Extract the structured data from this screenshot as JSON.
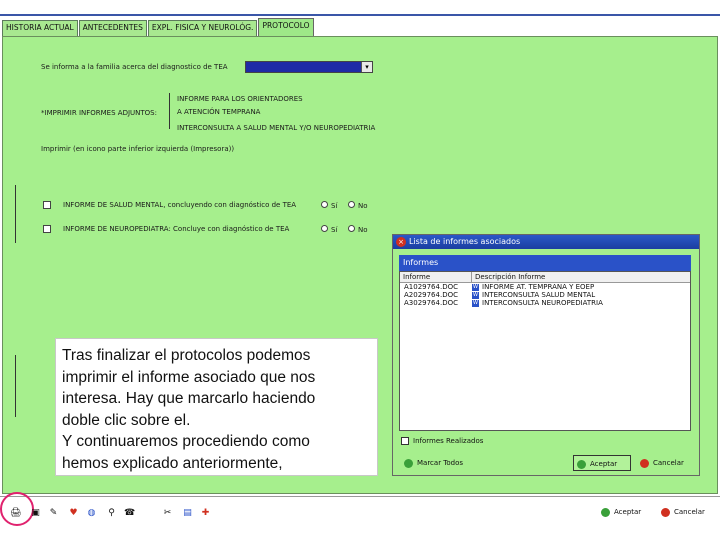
{
  "tabs": [
    {
      "label": "HISTORIA ACTUAL"
    },
    {
      "label": "ANTECEDENTES"
    },
    {
      "label": "EXPL. FISICA Y NEUROLÓG."
    },
    {
      "label": "PROTOCOLO"
    }
  ],
  "form": {
    "family_question": "Se informa a la familia acerca del diagnostico de TEA",
    "print_label": "*IMPRIMIR INFORMES ADJUNTOS:",
    "print_options": [
      "INFORME PARA LOS ORIENTADORES",
      "A ATENCIÓN TEMPRANA",
      "INTERCONSULTA A SALUD MENTAL Y/O NEUROPEDIATRIA"
    ],
    "print_hint": "Imprimir (en icono parte inferior izquierda (Impresora))",
    "report1": "INFORME DE SALUD MENTAL, concluyendo con diagnóstico de TEA",
    "report2": "INFORME DE NEUROPEDIATRA: Concluye con diagnóstico de TEA",
    "yes": "Sí",
    "no": "No"
  },
  "note": {
    "lines": [
      "Tras finalizar el protocolos podemos",
      "imprimir el informe asociado que nos",
      "interesa. Hay que marcarlo haciendo",
      "doble clic sobre el.",
      "Y continuaremos procediendo como",
      "hemos explicado anteriormente,"
    ]
  },
  "dialog": {
    "title": "Lista de informes asociados",
    "group": "Informes",
    "col1": "Informe",
    "col2": "Descripción Informe",
    "rows": [
      {
        "file": "A1029764.DOC",
        "desc": "INFORME AT. TEMPRANA Y EOEP"
      },
      {
        "file": "A2029764.DOC",
        "desc": "INTERCONSULTA SALUD MENTAL"
      },
      {
        "file": "A3029764.DOC",
        "desc": "INTERCONSULTA NEUROPEDIATRIA"
      }
    ],
    "footer": "Informes Realizados",
    "mark_all": "Marcar Todos",
    "accept": "Aceptar",
    "cancel": "Cancelar"
  },
  "toolbar": {
    "accept": "Aceptar",
    "cancel": "Cancelar"
  }
}
